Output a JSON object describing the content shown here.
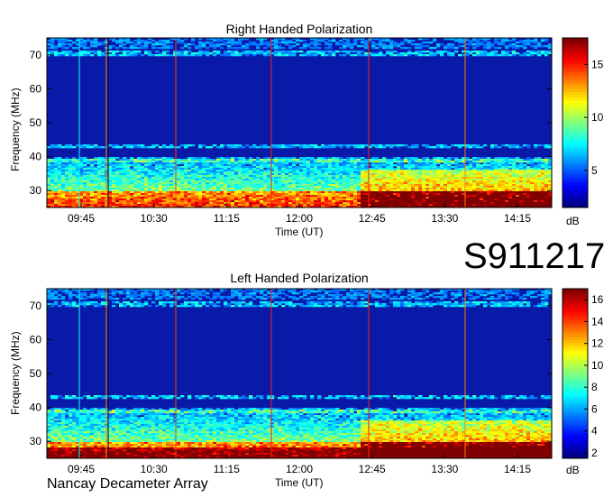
{
  "station_id": "S911217",
  "instrument": "Nancay Decameter Array",
  "colors": {
    "colormap": [
      "#00007f",
      "#0000ff",
      "#007fff",
      "#00ffff",
      "#7fff7f",
      "#ffff00",
      "#ff7f00",
      "#ff0000",
      "#7f0000"
    ]
  },
  "chart_data": [
    {
      "type": "heatmap",
      "title": "Right Handed Polarization",
      "xlabel": "Time (UT)",
      "ylabel": "Frequency (MHz)",
      "xticks": [
        "09:45",
        "10:30",
        "11:15",
        "12:00",
        "12:45",
        "13:30",
        "14:15"
      ],
      "yticks": [
        30,
        40,
        50,
        60,
        70
      ],
      "ylim": [
        25,
        75
      ],
      "colorbar": {
        "label": "dB",
        "ticks": [
          5,
          10,
          15
        ],
        "range": [
          1.5,
          17.5
        ]
      },
      "grid": false
    },
    {
      "type": "heatmap",
      "title": "Left Handed Polarization",
      "xlabel": "Time (UT)",
      "ylabel": "Frequency (MHz)",
      "xticks": [
        "09:45",
        "10:30",
        "11:15",
        "12:00",
        "12:45",
        "13:30",
        "14:15"
      ],
      "yticks": [
        30,
        40,
        50,
        60,
        70
      ],
      "ylim": [
        25,
        75
      ],
      "colorbar": {
        "label": "dB",
        "ticks": [
          2,
          4,
          6,
          8,
          10,
          12,
          14,
          16
        ],
        "range": [
          1.5,
          17
        ]
      },
      "grid": false
    }
  ]
}
